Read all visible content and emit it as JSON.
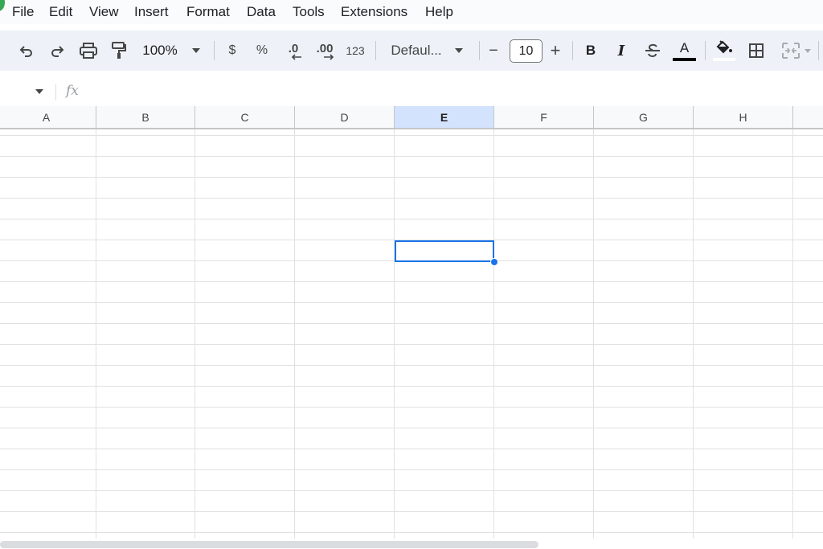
{
  "menu": {
    "items": [
      "File",
      "Edit",
      "View",
      "Insert",
      "Format",
      "Data",
      "Tools",
      "Extensions",
      "Help"
    ]
  },
  "toolbar": {
    "zoom": "100%",
    "currency": "$",
    "percent": "%",
    "decrease_decimal": ".0",
    "increase_decimal": ".00",
    "number_format": "123",
    "font": "Defaul...",
    "minus": "−",
    "font_size": "10",
    "plus": "+",
    "bold": "B",
    "italic": "I",
    "text_color_letter": "A",
    "text_color": "#000000",
    "fill_color": "#ffffff"
  },
  "formula_bar": {
    "fx": "fx"
  },
  "grid": {
    "columns": [
      "A",
      "B",
      "C",
      "D",
      "E",
      "F",
      "G",
      "H"
    ],
    "selected_column": "E",
    "accent_color": "#1a73e8"
  }
}
